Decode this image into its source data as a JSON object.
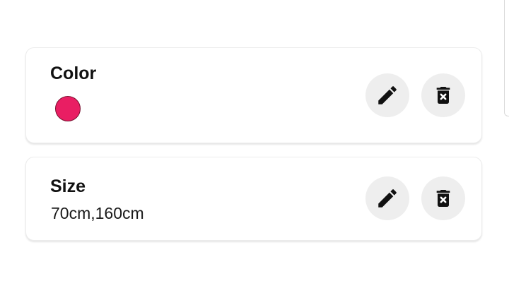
{
  "colors": {
    "swatch": "#e91e63",
    "icon": "#111111",
    "button_bg": "#eeeeee"
  },
  "attributes": [
    {
      "name": "Color",
      "swatch_color": "#e91e63",
      "edit_icon": "pencil-icon",
      "delete_icon": "trash-x-icon"
    },
    {
      "name": "Size",
      "value": "70cm,160cm",
      "edit_icon": "pencil-icon",
      "delete_icon": "trash-x-icon"
    }
  ]
}
